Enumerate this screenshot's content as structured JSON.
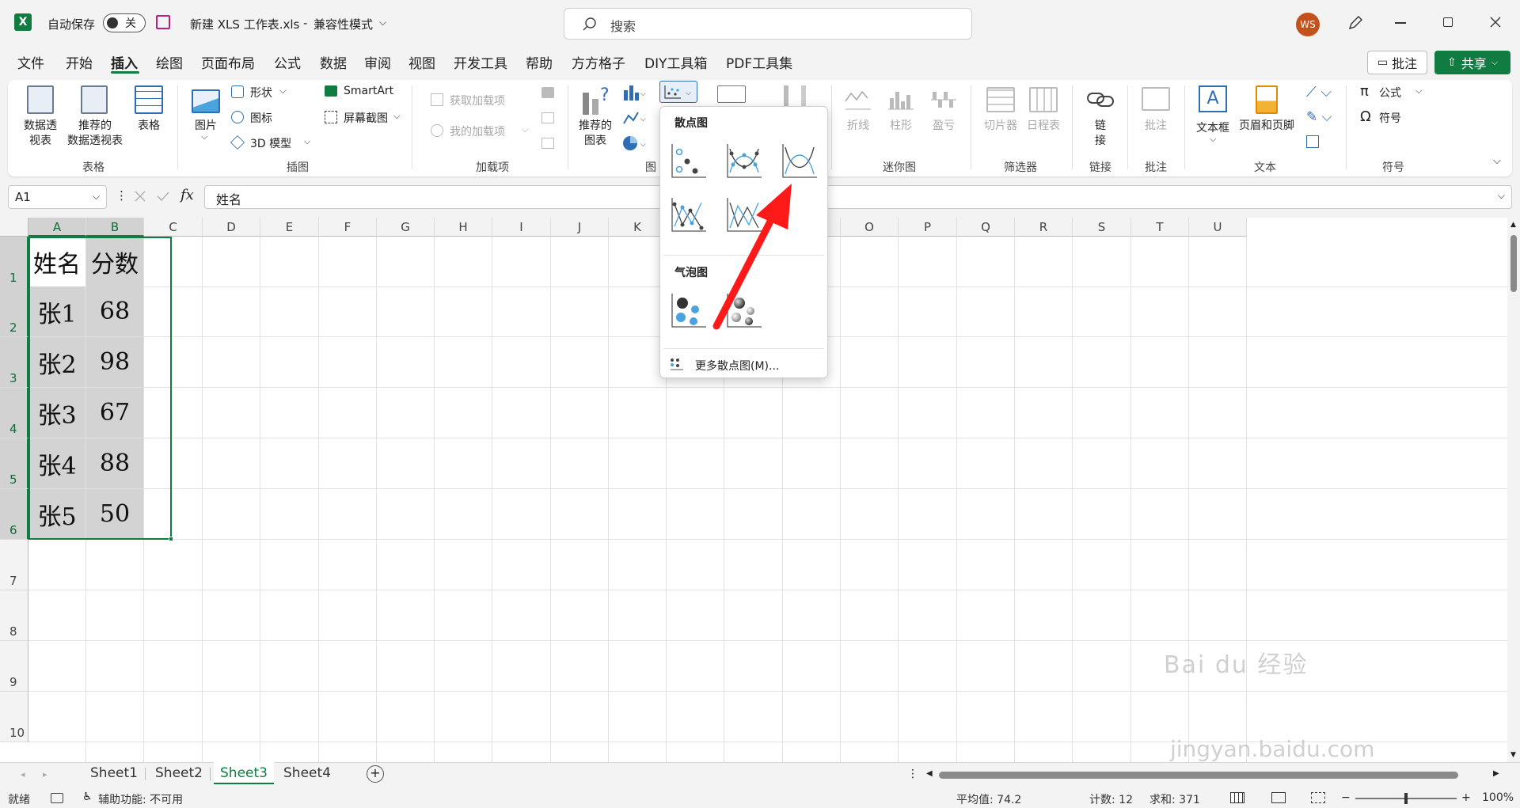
{
  "titlebar": {
    "autosave_label": "自动保存",
    "autosave_state": "关",
    "filename": "新建 XLS 工作表.xls",
    "separator": "-",
    "mode": "兼容性模式",
    "search_placeholder": "搜索",
    "avatar_initials": "WS"
  },
  "menu": {
    "items": [
      "文件",
      "开始",
      "插入",
      "绘图",
      "页面布局",
      "公式",
      "数据",
      "审阅",
      "视图",
      "开发工具",
      "帮助",
      "方方格子",
      "DIY工具箱",
      "PDF工具集"
    ],
    "comment_label": "批注",
    "share_label": "共享"
  },
  "ribbon": {
    "groups": {
      "tables": "表格",
      "illustrations": "插图",
      "addins": "加载项",
      "charts": "图",
      "sparklines": "迷你图",
      "filters": "筛选器",
      "links": "链接",
      "comments": "批注",
      "text": "文本",
      "symbols": "符号"
    },
    "pivot1": "数据透",
    "pivot2": "视表",
    "rec_pivot1": "推荐的",
    "rec_pivot2": "数据透视表",
    "table": "表格",
    "picture": "图片",
    "shapes": "形状",
    "icons": "图标",
    "model3d": "3D 模型",
    "smartart": "SmartArt",
    "screenshot": "屏幕截图",
    "get_addins": "获取加载项",
    "my_addins": "我的加载项",
    "rec_chart1": "推荐的",
    "rec_chart2": "图表",
    "spark_line": "折线",
    "spark_column": "柱形",
    "spark_winloss": "盈亏",
    "slicer": "切片器",
    "timeline": "日程表",
    "link1": "链",
    "link2": "接",
    "comment": "批注",
    "textbox": "文本框",
    "header_footer": "页眉和页脚",
    "equation": "公式",
    "symbol": "符号"
  },
  "formula": {
    "namebox": "A1",
    "fx": "fx",
    "content": "姓名"
  },
  "grid": {
    "columns": [
      "A",
      "B",
      "C",
      "D",
      "E",
      "F",
      "G",
      "H",
      "I",
      "J",
      "K",
      "L",
      "M",
      "N",
      "O",
      "P",
      "Q",
      "R",
      "S",
      "T",
      "U"
    ],
    "rows": [
      "1",
      "2",
      "3",
      "4",
      "5",
      "6",
      "7",
      "8",
      "9",
      "10"
    ],
    "cells": [
      [
        "姓名",
        "分数"
      ],
      [
        "张1",
        "68"
      ],
      [
        "张2",
        "98"
      ],
      [
        "张3",
        "67"
      ],
      [
        "张4",
        "88"
      ],
      [
        "张5",
        "50"
      ]
    ]
  },
  "dropdown": {
    "scatter_title": "散点图",
    "bubble_title": "气泡图",
    "more": "更多散点图(M)..."
  },
  "sheets": [
    "Sheet1",
    "Sheet2",
    "Sheet3",
    "Sheet4"
  ],
  "active_sheet": "Sheet3",
  "status": {
    "ready": "就绪",
    "accessibility": "辅助功能: 不可用",
    "average": "平均值: 74.2",
    "count": "计数: 12",
    "sum": "求和: 371",
    "zoom": "100%"
  },
  "watermark": {
    "brand": "Bai du 经验",
    "url": "jingyan.baidu.com"
  },
  "colors": {
    "excel_green": "#107c41",
    "selection_fill": "#d3d3d3",
    "arrow_red": "#ff1a1a",
    "chart_blue": "#4aa3df"
  }
}
